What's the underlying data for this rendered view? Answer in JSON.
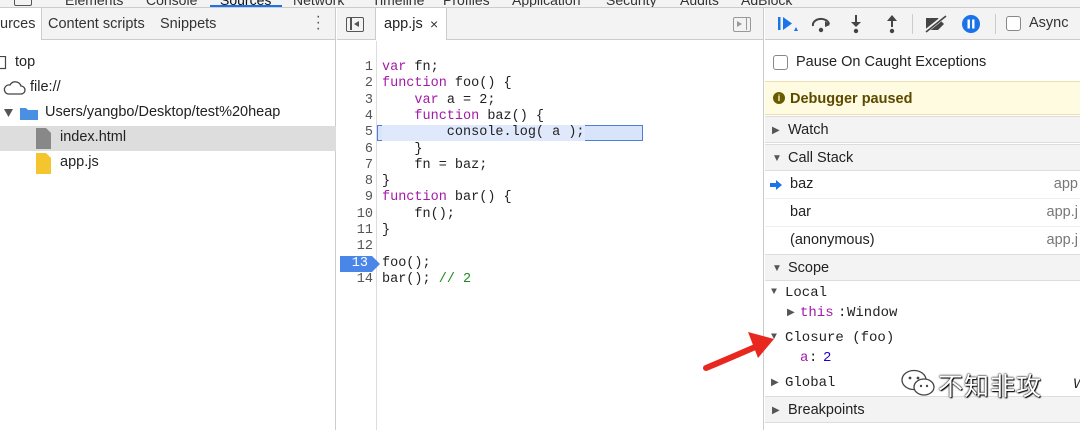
{
  "top_tabs": [
    "Elements",
    "Console",
    "Sources",
    "Network",
    "Timeline",
    "Profiles",
    "Application",
    "Security",
    "Audits",
    "AdBlock"
  ],
  "navigator": {
    "tabs": [
      "Sources",
      "Content scripts",
      "Snippets"
    ],
    "active_tab_visible": "urces",
    "tree": [
      {
        "label": "top",
        "icon": "frame-icon"
      },
      {
        "label": "file://",
        "icon": "cloud-icon"
      },
      {
        "label": "Users/yangbo/Desktop/test%20heap",
        "icon": "folder-icon"
      },
      {
        "label": "index.html",
        "icon": "html-file-icon",
        "selected": true
      },
      {
        "label": "app.js",
        "icon": "js-file-icon"
      }
    ]
  },
  "editor": {
    "file_tab": "app.js",
    "close_glyph": "×",
    "execution_line": 5,
    "breakpoint_line": 13,
    "lines": [
      {
        "n": "1",
        "code": "var fn;"
      },
      {
        "n": "2",
        "code": "function foo() {"
      },
      {
        "n": "3",
        "code": "    var a = 2;"
      },
      {
        "n": "4",
        "code": "    function baz() {"
      },
      {
        "n": "5",
        "code": "        console.log( a );"
      },
      {
        "n": "6",
        "code": "    }"
      },
      {
        "n": "7",
        "code": "    fn = baz;"
      },
      {
        "n": "8",
        "code": "}"
      },
      {
        "n": "9",
        "code": "function bar() {"
      },
      {
        "n": "10",
        "code": "    fn();"
      },
      {
        "n": "11",
        "code": "}"
      },
      {
        "n": "12",
        "code": ""
      },
      {
        "n": "13",
        "code": "foo();"
      },
      {
        "n": "14",
        "code": "bar(); // 2"
      }
    ]
  },
  "debugger": {
    "async_label": "Async",
    "pause_on_caught": "Pause On Caught Exceptions",
    "paused_banner": "Debugger paused",
    "sections": {
      "watch": "Watch",
      "call_stack": "Call Stack",
      "scope": "Scope",
      "breakpoints": "Breakpoints"
    },
    "call_stack": [
      {
        "name": "baz",
        "file": "app",
        "active": true
      },
      {
        "name": "bar",
        "file": "app.j"
      },
      {
        "name": "(anonymous)",
        "file": "app.j"
      }
    ],
    "scope": {
      "local_label": "Local",
      "this_key": "this",
      "this_value": "Window",
      "closure_label": "Closure (foo)",
      "closure_var": "a",
      "closure_value": "2",
      "global_label": "Global",
      "global_trailing": "W"
    }
  },
  "watermark": "不知非攻",
  "colors": {
    "accent": "#1a73e8",
    "arrow": "#e8281e",
    "banner": "#fffbe0"
  }
}
